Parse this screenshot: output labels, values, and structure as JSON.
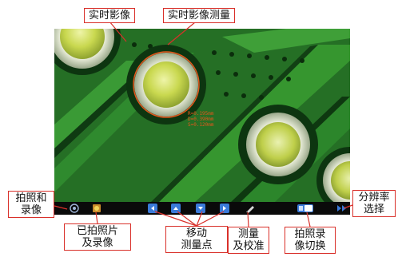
{
  "callouts": {
    "live_view": "实时影像",
    "live_view_measure": "实时影像测量",
    "capture_record": [
      "拍照和",
      "录像"
    ],
    "captured_files": [
      "已拍照片",
      "及录像"
    ],
    "move_measure_point": [
      "移动",
      "测量点"
    ],
    "measure_calibrate": [
      "测量",
      "及校准"
    ],
    "capture_record_switch": [
      "拍照录",
      "像切换"
    ],
    "resolution_select": [
      "分辨率",
      "选择"
    ]
  },
  "measurement_readout": [
    "R=0.195mm",
    "D=0.390mm",
    "S=0.120mm"
  ],
  "toolbar": {
    "buttons": [
      "camera-record-icon",
      "gallery-icon",
      "arrow-left-icon",
      "arrow-up-icon",
      "arrow-down-icon",
      "arrow-right-icon",
      "measure-pen-icon",
      "capture-mode-toggle",
      "resolution-arrows-icon"
    ]
  },
  "colors": {
    "pcb_green": "#2e8b2e",
    "pad_yellow": "#c8d850",
    "callout_border": "#d9302a",
    "toolbar_bg": "#0a0a0a",
    "toolbar_icon_blue": "#3a7ad9",
    "measure_orange": "#e4571c"
  }
}
